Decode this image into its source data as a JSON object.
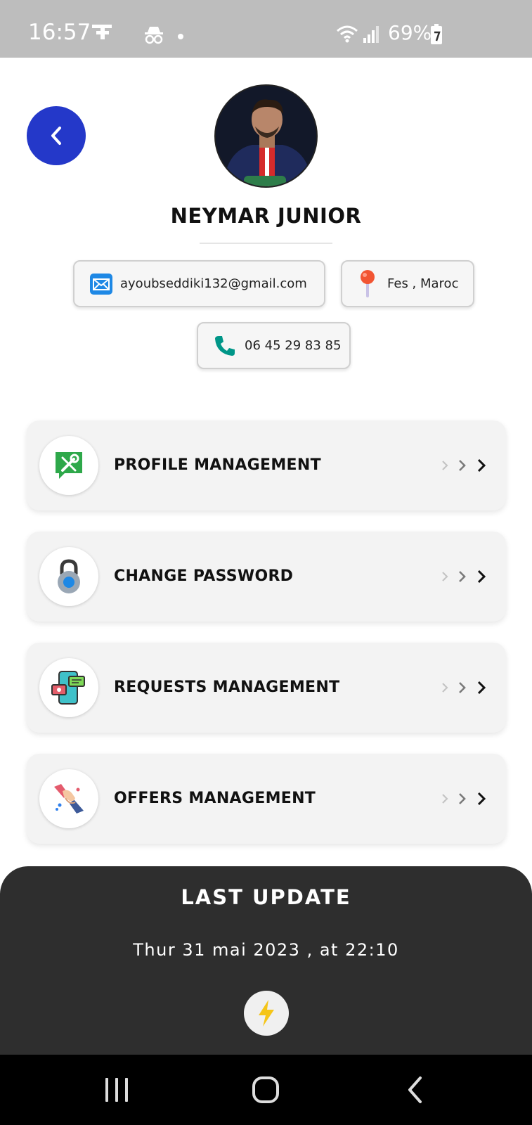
{
  "status_bar": {
    "time": "16:57",
    "battery": "69%",
    "icons": [
      "app-notification-icon",
      "incognito-icon",
      "dot-icon",
      "wifi-icon",
      "signal-icon",
      "battery-icon"
    ]
  },
  "profile": {
    "name": "NEYMAR JUNIOR",
    "email": "ayoubseddiki132@gmail.com",
    "location": "Fes , Maroc",
    "phone": "06 45 29 83 85"
  },
  "menu": {
    "items": [
      {
        "label": "PROFILE MANAGEMENT",
        "icon": "profile-tools-icon"
      },
      {
        "label": "CHANGE PASSWORD",
        "icon": "padlock-icon"
      },
      {
        "label": "REQUESTS MANAGEMENT",
        "icon": "requests-phone-icon"
      },
      {
        "label": "OFFERS MANAGEMENT",
        "icon": "handshake-icon"
      }
    ]
  },
  "last_update": {
    "title": "LAST UPDATE",
    "date": "Thur 31 mai 2023 , at 22:10"
  },
  "colors": {
    "accent": "#2438c9",
    "panel": "#2e2e2e",
    "card": "#f3f3f3",
    "status_bar": "#bdbdbd",
    "bolt": "#f5c518"
  }
}
